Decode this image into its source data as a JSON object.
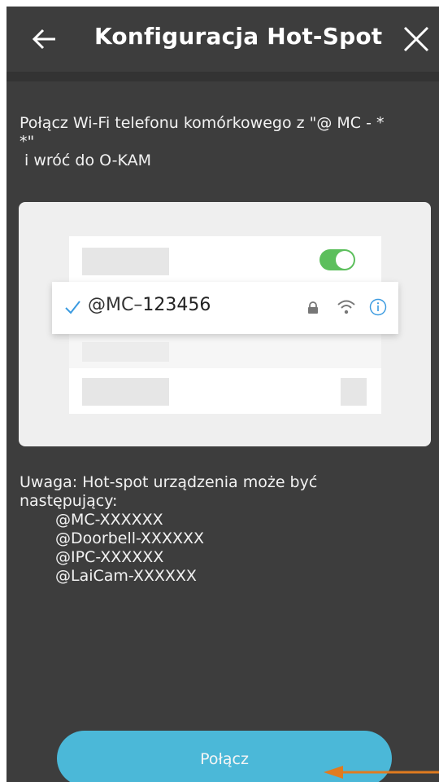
{
  "header": {
    "title": "Konfiguracja Hot-Spot",
    "back_icon": "arrow-left-icon",
    "close_icon": "close-icon"
  },
  "instruction": {
    "line1": "Połącz Wi-Fi telefonu komórkowego z \"@ MC - *",
    "line2": "*\"",
    "line3": " i wróć do O-KAM"
  },
  "illustration": {
    "network_prefix": "@MC–",
    "network_suffix": "123456",
    "toggle_on": true,
    "icons": [
      "check-icon",
      "lock-icon",
      "wifi-icon",
      "info-icon"
    ]
  },
  "note": {
    "line1": "Uwaga: Hot-spot urządzenia może być",
    "line2": "następujący:",
    "examples": [
      "@MC-XXXXXX",
      "@Doorbell-XXXXXX",
      "@IPC-XXXXXX",
      "@LaiCam-XXXXXX"
    ]
  },
  "connect_button": {
    "label": "Połącz"
  },
  "colors": {
    "background": "#3d3d3d",
    "header_divider": "#333333",
    "button": "#4bb8d8",
    "toggle": "#5cbf5c",
    "check_and_info": "#3a9ae0",
    "annotation_arrow": "#e07b1f"
  }
}
